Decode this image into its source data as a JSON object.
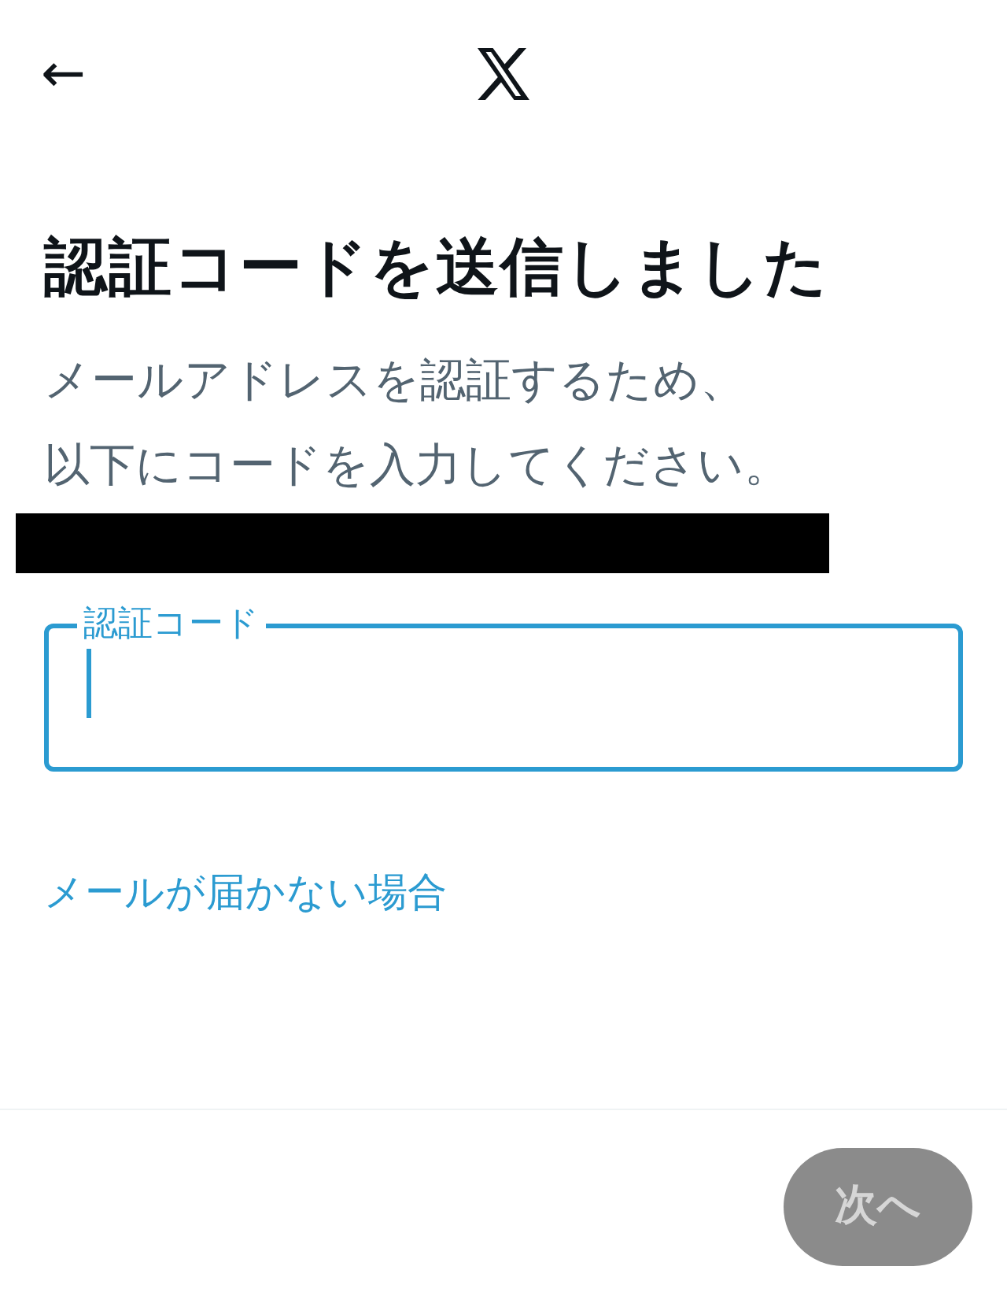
{
  "header": {
    "back": "←"
  },
  "title": "認証コードを送信しました",
  "description": [
    "メールアドレスを認証するため、",
    "以下にコードを入力してください。"
  ],
  "redacted": true,
  "code_field": {
    "label": "認証コード",
    "focused": true
  },
  "help_link": "メールが届かない場合",
  "next_button": {
    "label": "次へ",
    "disabled": true
  }
}
